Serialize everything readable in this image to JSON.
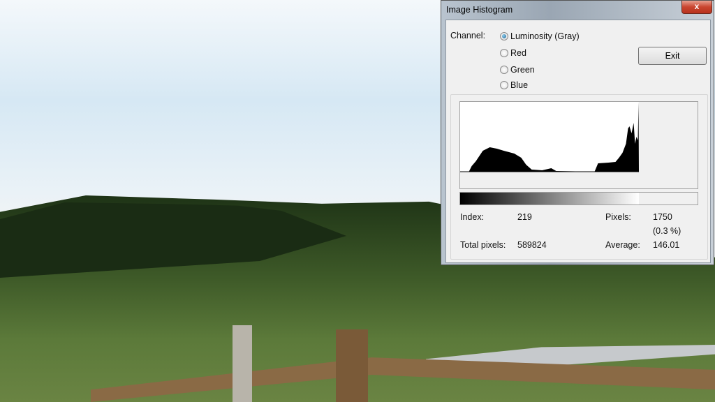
{
  "window": {
    "title": "Image Histogram",
    "close_label": "x"
  },
  "channel": {
    "label": "Channel:",
    "options": [
      "Luminosity (Gray)",
      "Red",
      "Green",
      "Blue"
    ],
    "selected": 0
  },
  "exit_label": "Exit",
  "stats": {
    "index_label": "Index:",
    "index": "219",
    "pixels_label": "Pixels:",
    "pixels": "1750",
    "percent": "(0.3 %)",
    "total_label": "Total pixels:",
    "total": "589824",
    "average_label": "Average:",
    "average": "146.01"
  },
  "chart_data": {
    "type": "area",
    "xlim": [
      0,
      255
    ],
    "ylim": [
      0,
      100
    ],
    "points": [
      [
        0,
        0
      ],
      [
        12,
        0
      ],
      [
        16,
        8
      ],
      [
        22,
        15
      ],
      [
        32,
        30
      ],
      [
        42,
        35
      ],
      [
        52,
        33
      ],
      [
        62,
        30
      ],
      [
        77,
        26
      ],
      [
        87,
        20
      ],
      [
        94,
        10
      ],
      [
        102,
        3
      ],
      [
        117,
        2
      ],
      [
        130,
        5
      ],
      [
        137,
        1
      ],
      [
        192,
        0
      ],
      [
        197,
        12
      ],
      [
        212,
        13
      ],
      [
        222,
        14
      ],
      [
        227,
        20
      ],
      [
        232,
        27
      ],
      [
        237,
        40
      ],
      [
        240,
        62
      ],
      [
        242,
        65
      ],
      [
        245,
        55
      ],
      [
        248,
        70
      ],
      [
        250,
        40
      ],
      [
        252,
        50
      ],
      [
        254,
        45
      ],
      [
        255,
        100
      ]
    ]
  }
}
